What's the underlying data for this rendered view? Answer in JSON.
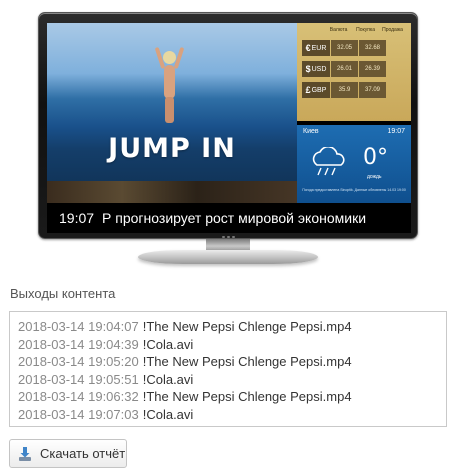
{
  "tv": {
    "video_headline": "JUMP IN",
    "currency": {
      "headers": [
        "Валюта",
        "Покупка",
        "Продажа"
      ],
      "rows": [
        {
          "symbol": "€",
          "code": "EUR",
          "buy": "32.05",
          "sell": "32.68"
        },
        {
          "symbol": "$",
          "code": "USD",
          "buy": "26.01",
          "sell": "26.39"
        },
        {
          "symbol": "£",
          "code": "GBP",
          "buy": "35.9",
          "sell": "37.09"
        }
      ]
    },
    "weather": {
      "city": "Киев",
      "time": "19:07",
      "temperature": "0°",
      "condition": "дождь",
      "icon": "rain-cloud-icon",
      "footer": "Погода предоставлена Sinoptik. Данные обновлены 14.03 19:00"
    },
    "ticker": {
      "time": "19:07",
      "text": "Р прогнозирует рост мировой экономики"
    }
  },
  "content_outputs": {
    "label": "Выходы контента",
    "rows": [
      {
        "timestamp": "2018-03-14 19:04:07",
        "file": "!The New Pepsi Chlenge Pepsi.mp4"
      },
      {
        "timestamp": "2018-03-14 19:04:39",
        "file": "!Cola.avi"
      },
      {
        "timestamp": "2018-03-14 19:05:20",
        "file": "!The New Pepsi Chlenge Pepsi.mp4"
      },
      {
        "timestamp": "2018-03-14 19:05:51",
        "file": "!Cola.avi"
      },
      {
        "timestamp": "2018-03-14 19:06:32",
        "file": "!The New Pepsi Chlenge Pepsi.mp4"
      },
      {
        "timestamp": "2018-03-14 19:07:03",
        "file": "!Cola.avi"
      }
    ]
  },
  "download_button": {
    "label": "Скачать отчёт",
    "icon": "download-icon"
  },
  "colors": {
    "fx_background": "#c9a85a",
    "weather_background": "#1e6db2"
  }
}
